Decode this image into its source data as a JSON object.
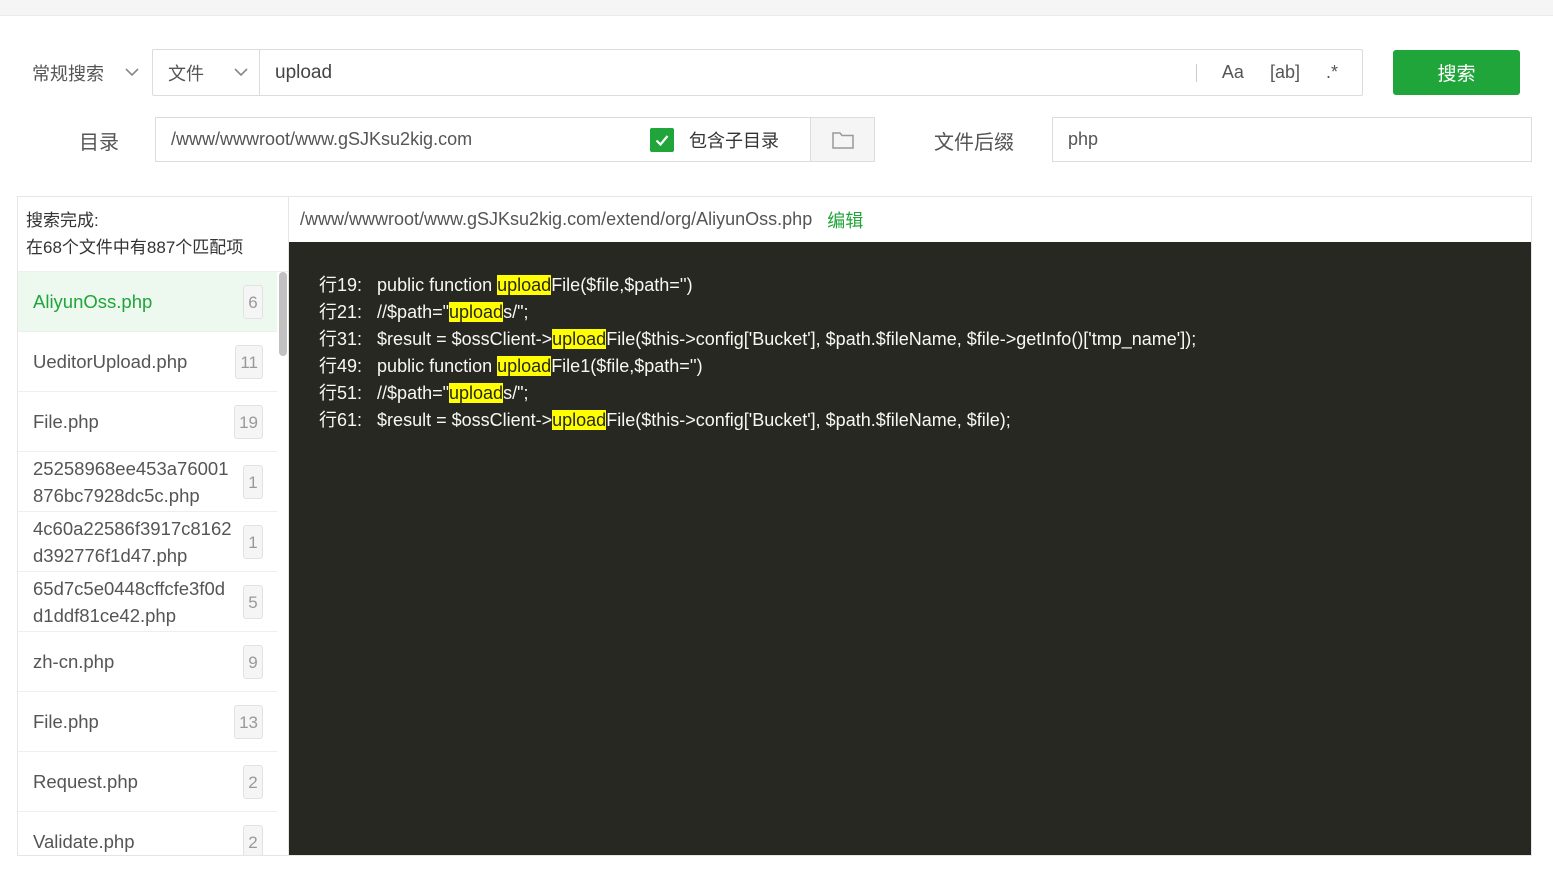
{
  "search": {
    "mode": "常规搜索",
    "type": "文件",
    "query": "upload",
    "options": [
      "Aa",
      "[ab]",
      ".*"
    ],
    "button": "搜索"
  },
  "directory": {
    "label": "目录",
    "path": "/www/wwwroot/www.gSJKsu2kig.com",
    "include_subdirs_label": "包含子目录",
    "include_subdirs": true
  },
  "extension": {
    "label": "文件后缀",
    "value": "php"
  },
  "results": {
    "status_line1": "搜索完成:",
    "status_line2": "在68个文件中有887个匹配项",
    "files": [
      {
        "name": "AliyunOss.php",
        "count": "6",
        "active": true
      },
      {
        "name": "UeditorUpload.php",
        "count": "11"
      },
      {
        "name": "File.php",
        "count": "19"
      },
      {
        "name": "25258968ee453a76001876bc7928dc5c.php",
        "count": "1"
      },
      {
        "name": "4c60a22586f3917c8162d392776f1d47.php",
        "count": "1"
      },
      {
        "name": "65d7c5e0448cffcfe3f0dd1ddf81ce42.php",
        "count": "5"
      },
      {
        "name": "zh-cn.php",
        "count": "9"
      },
      {
        "name": "File.php",
        "count": "13"
      },
      {
        "name": "Request.php",
        "count": "2"
      },
      {
        "name": "Validate.php",
        "count": "2"
      }
    ]
  },
  "preview": {
    "path": "/www/wwwroot/www.gSJKsu2kig.com/extend/org/AliyunOss.php",
    "edit_label": "编辑",
    "lines": [
      {
        "label": "行19:",
        "before": "public function ",
        "match": "upload",
        "after": "File($file,$path='')"
      },
      {
        "label": "行21:",
        "before": "//$path=\"",
        "match": "upload",
        "after": "s/\";"
      },
      {
        "label": "行31:",
        "before": "$result = $ossClient->",
        "match": "upload",
        "after": "File($this->config['Bucket'], $path.$fileName, $file->getInfo()['tmp_name']);"
      },
      {
        "label": "行49:",
        "before": "public function ",
        "match": "upload",
        "after": "File1($file,$path='')"
      },
      {
        "label": "行51:",
        "before": "//$path=\"",
        "match": "upload",
        "after": "s/\";"
      },
      {
        "label": "行61:",
        "before": "$result = $ossClient->",
        "match": "upload",
        "after": "File($this->config['Bucket'], $path.$fileName, $file);"
      }
    ]
  },
  "colors": {
    "accent": "#20a53a",
    "code_bg": "#272822",
    "highlight": "#ffff00"
  },
  "icons": {
    "dropdown": "chevron-down-icon",
    "folder": "folder-icon",
    "check": "check-icon"
  }
}
